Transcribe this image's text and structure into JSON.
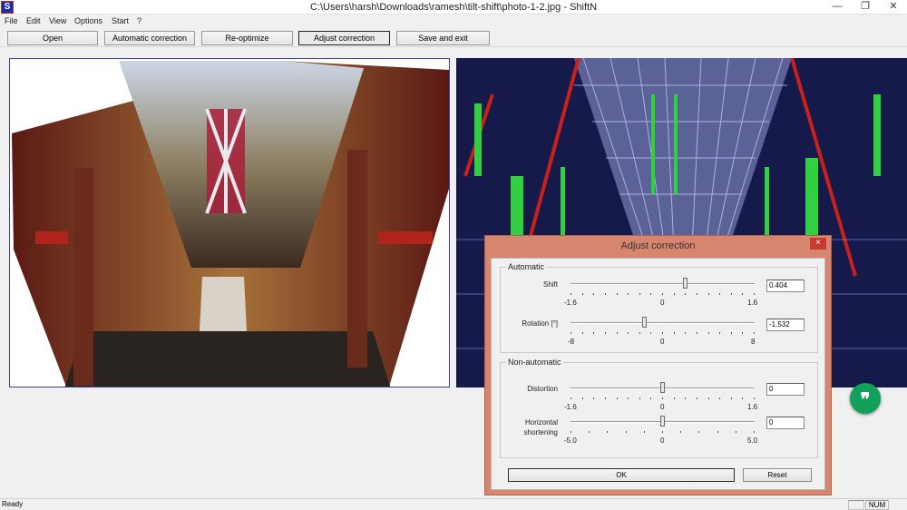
{
  "window": {
    "title": "C:\\Users\\harsh\\Downloads\\ramesh\\tilt-shift\\photo-1-2.jpg - ShiftN",
    "app_icon_letter": "S",
    "minimize_glyph": "—",
    "restore_glyph": "❐",
    "close_glyph": "✕"
  },
  "menu": [
    "File",
    "Edit",
    "View",
    "Options",
    "Start",
    "?"
  ],
  "toolbar": {
    "open": "Open",
    "automatic_correction": "Automatic correction",
    "reoptimize": "Re-optimize",
    "adjust_correction": "Adjust correction",
    "save_and_exit": "Save and exit"
  },
  "dialog": {
    "title": "Adjust correction",
    "close_glyph": "×",
    "automatic": {
      "legend": "Automatic",
      "shift": {
        "label": "Shift",
        "value": "0.404",
        "min": "-1.6",
        "mid": "0",
        "max": "1.6",
        "level": 0.404,
        "range": [
          -1.6,
          1.6
        ]
      },
      "rotation": {
        "label": "Rotation [°]",
        "value": "-1.532",
        "min": "-8",
        "mid": "0",
        "max": "8",
        "level": -1.532,
        "range": [
          -8,
          8
        ]
      }
    },
    "non_automatic": {
      "legend": "Non-automatic",
      "distortion": {
        "label": "Distortion",
        "value": "0",
        "min": "-1.6",
        "mid": "0",
        "max": "1.6",
        "level": 0,
        "range": [
          -1.6,
          1.6
        ]
      },
      "horizontal_shortening": {
        "label_line1": "Horizontal",
        "label_line2": "shortening",
        "value": "0",
        "min": "-5.0",
        "mid": "0",
        "max": "5.0",
        "level": 0,
        "range": [
          -5,
          5
        ]
      }
    },
    "ok": "OK",
    "reset": "Reset"
  },
  "status": {
    "text": "Ready",
    "num": "NUM"
  },
  "icons": {
    "floating": "hangouts-quote-icon",
    "floating_glyph": "❞"
  },
  "colors": {
    "dialog_frame": "#d6866e",
    "pane_border": "#3a3fb8",
    "float_button": "#11a05a"
  }
}
